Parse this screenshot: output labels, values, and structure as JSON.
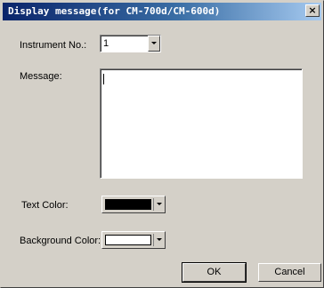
{
  "window": {
    "title": "Display message(for CM-700d/CM-600d)",
    "close_glyph": "×"
  },
  "form": {
    "instrument_label": "Instrument No.:",
    "instrument_value": "1",
    "message_label": "Message:",
    "message_value": "",
    "text_color_label": "Text Color:",
    "text_color_value": "#000000",
    "background_color_label": "Background Color:",
    "background_color_value": "#ffffff"
  },
  "buttons": {
    "ok": "OK",
    "cancel": "Cancel"
  },
  "icons": {
    "close": "close-icon",
    "dropdown": "chevron-down-icon"
  }
}
